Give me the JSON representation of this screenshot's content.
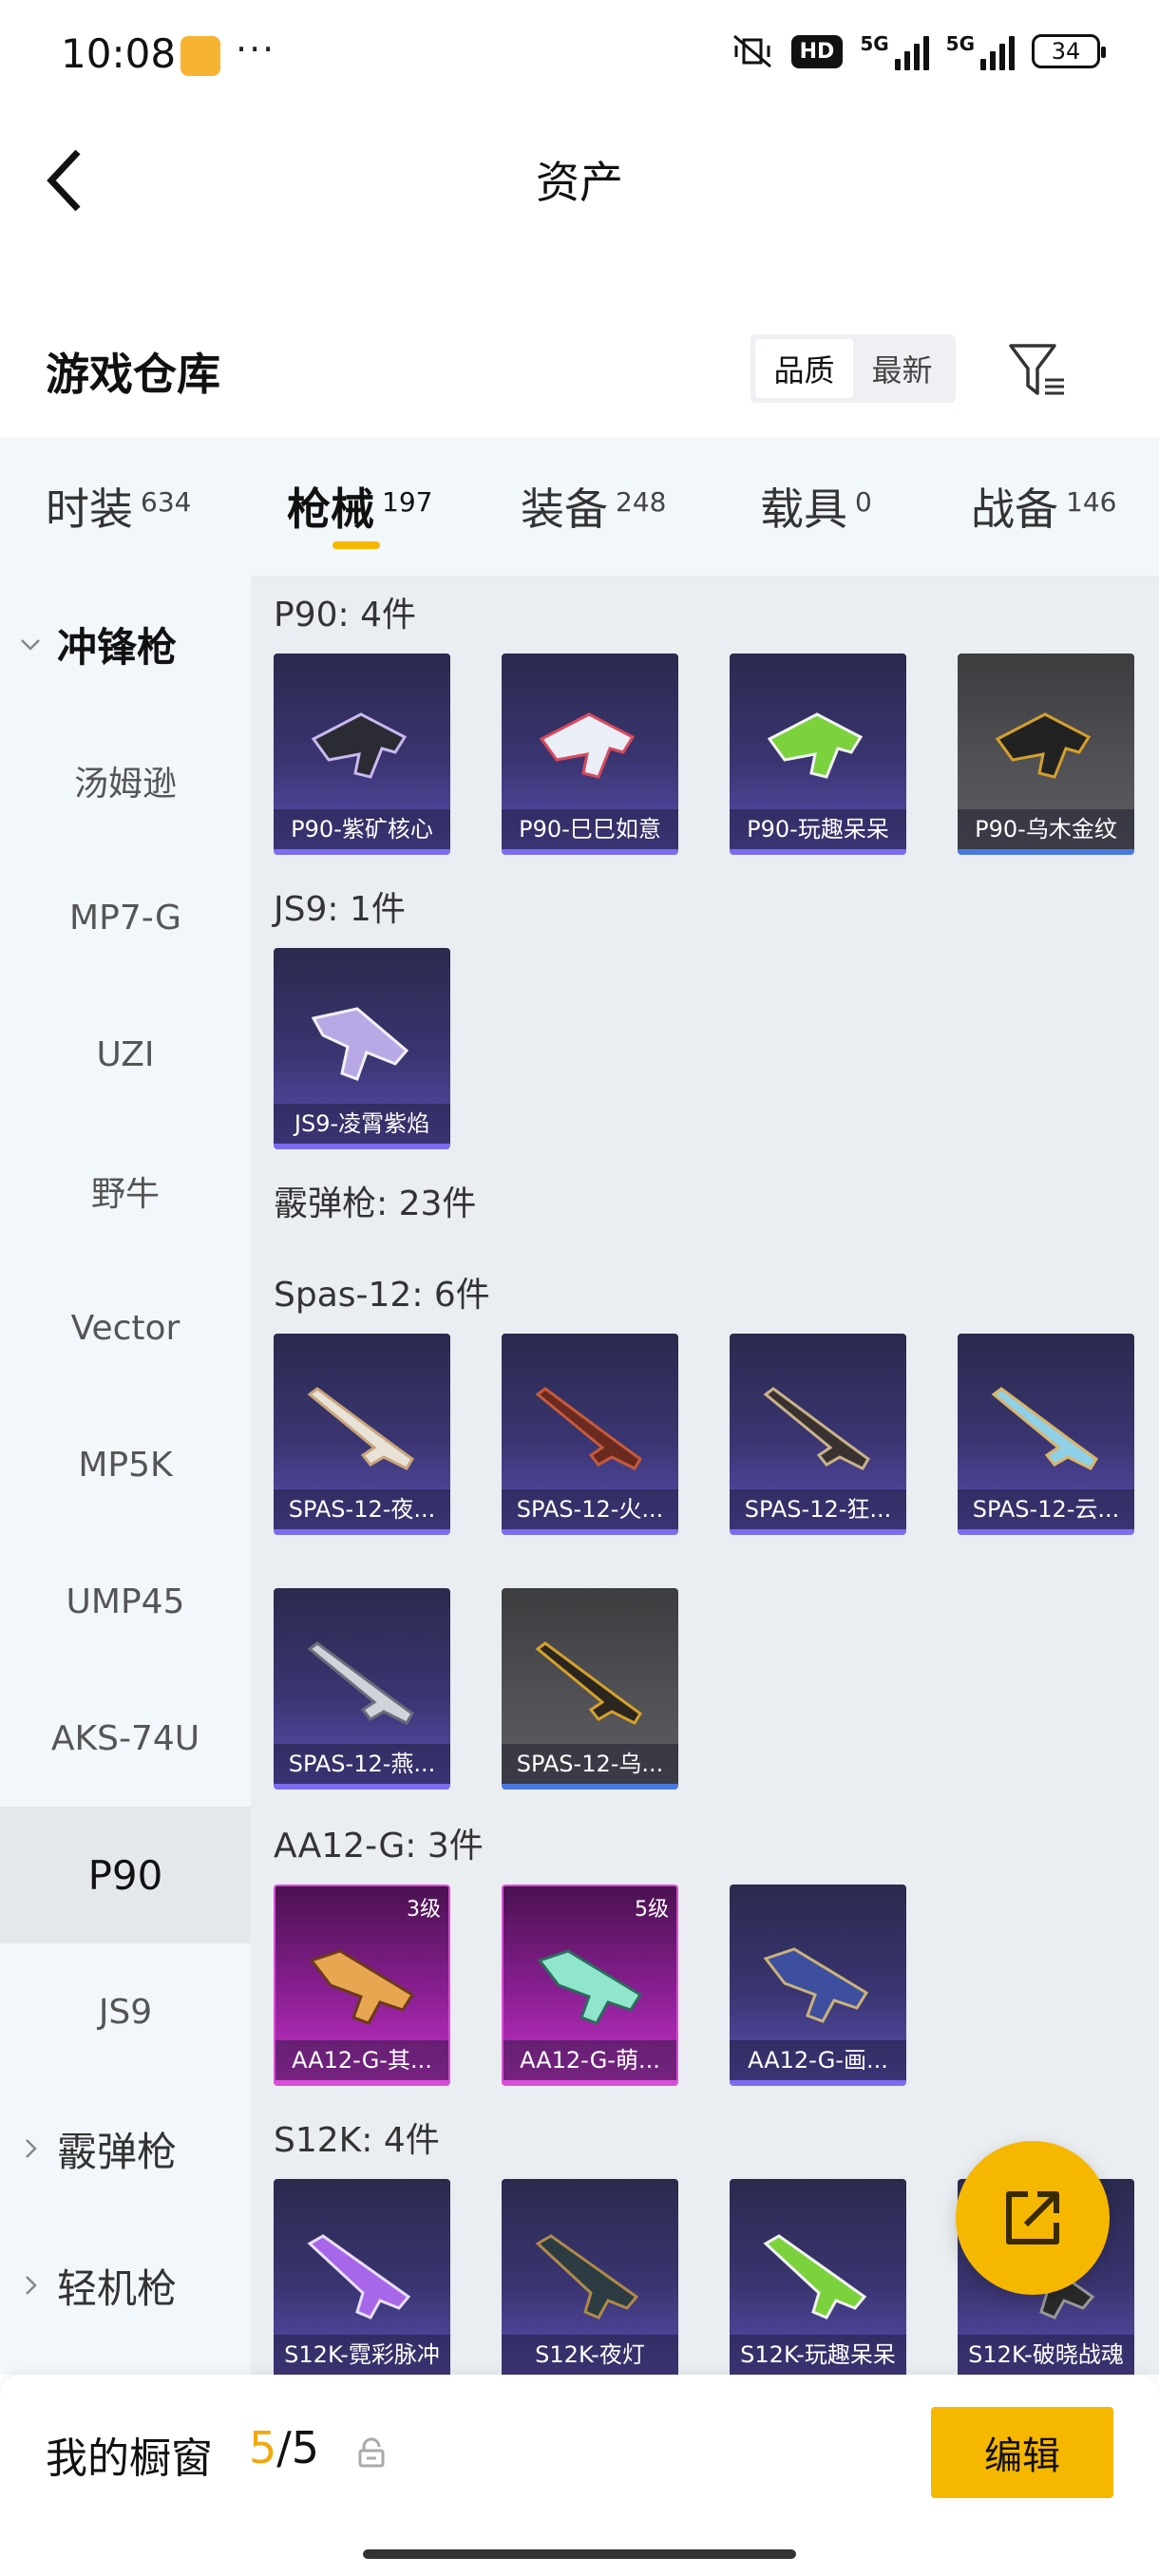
{
  "status_bar": {
    "time": "10:08",
    "dots": "···",
    "hd": "HD",
    "signal1": "5G",
    "signal2": "5G",
    "battery": "34"
  },
  "header": {
    "title": "资产"
  },
  "warehouse": {
    "title": "游戏仓库",
    "sort_options": [
      "品质",
      "最新"
    ],
    "sort_active": "品质"
  },
  "category_tabs": [
    {
      "label": "时装",
      "count": "634"
    },
    {
      "label": "枪械",
      "count": "197",
      "active": true
    },
    {
      "label": "装备",
      "count": "248"
    },
    {
      "label": "载具",
      "count": "0"
    },
    {
      "label": "战备",
      "count": "146"
    }
  ],
  "sidebar": {
    "items": [
      {
        "label": "冲锋枪",
        "type": "group",
        "open": true
      },
      {
        "label": "汤姆逊"
      },
      {
        "label": "MP7-G"
      },
      {
        "label": "UZI"
      },
      {
        "label": "野牛"
      },
      {
        "label": "Vector"
      },
      {
        "label": "MP5K"
      },
      {
        "label": "UMP45"
      },
      {
        "label": "AKS-74U"
      },
      {
        "label": "P90",
        "selected": true
      },
      {
        "label": "JS9"
      },
      {
        "label": "霰弹枪",
        "type": "group"
      },
      {
        "label": "轻机枪",
        "type": "group"
      }
    ]
  },
  "sections": [
    {
      "title": "P90: 4件",
      "items": [
        {
          "name": "P90-紫矿核心",
          "style": "purple"
        },
        {
          "name": "P90-巳巳如意",
          "style": "purple"
        },
        {
          "name": "P90-玩趣呆呆",
          "style": "purple"
        },
        {
          "name": "P90-乌木金纹",
          "style": "grey"
        }
      ]
    },
    {
      "title": "JS9: 1件",
      "items": [
        {
          "name": "JS9-凌霄紫焰",
          "style": "purple"
        }
      ]
    },
    {
      "title": "霰弹枪: 23件",
      "items": []
    },
    {
      "title": "Spas-12: 6件",
      "items": [
        {
          "name": "SPAS-12-夜...",
          "style": "purple"
        },
        {
          "name": "SPAS-12-火...",
          "style": "purple"
        },
        {
          "name": "SPAS-12-狂...",
          "style": "purple"
        },
        {
          "name": "SPAS-12-云...",
          "style": "purple"
        },
        {
          "name": "SPAS-12-燕...",
          "style": "purple"
        },
        {
          "name": "SPAS-12-乌...",
          "style": "grey"
        }
      ]
    },
    {
      "title": "AA12-G: 3件",
      "items": [
        {
          "name": "AA12-G-其...",
          "style": "pink",
          "level": "3级"
        },
        {
          "name": "AA12-G-萌...",
          "style": "pink",
          "level": "5级"
        },
        {
          "name": "AA12-G-画...",
          "style": "purple"
        }
      ]
    },
    {
      "title": "S12K: 4件",
      "items": [
        {
          "name": "S12K-霓彩脉冲",
          "style": "purple"
        },
        {
          "name": "S12K-夜灯",
          "style": "purple"
        },
        {
          "name": "S12K-玩趣呆呆",
          "style": "purple"
        },
        {
          "name": "S12K-破晓战魂",
          "style": "purple"
        }
      ]
    }
  ],
  "bottom": {
    "label": "我的橱窗",
    "current": "5",
    "separator": "/",
    "total": "5",
    "edit": "编辑"
  },
  "colors": {
    "accent": "#f6b700",
    "purple_card": "#3a3571",
    "pink_card": "#c531c9",
    "grey_card": "#505055"
  }
}
